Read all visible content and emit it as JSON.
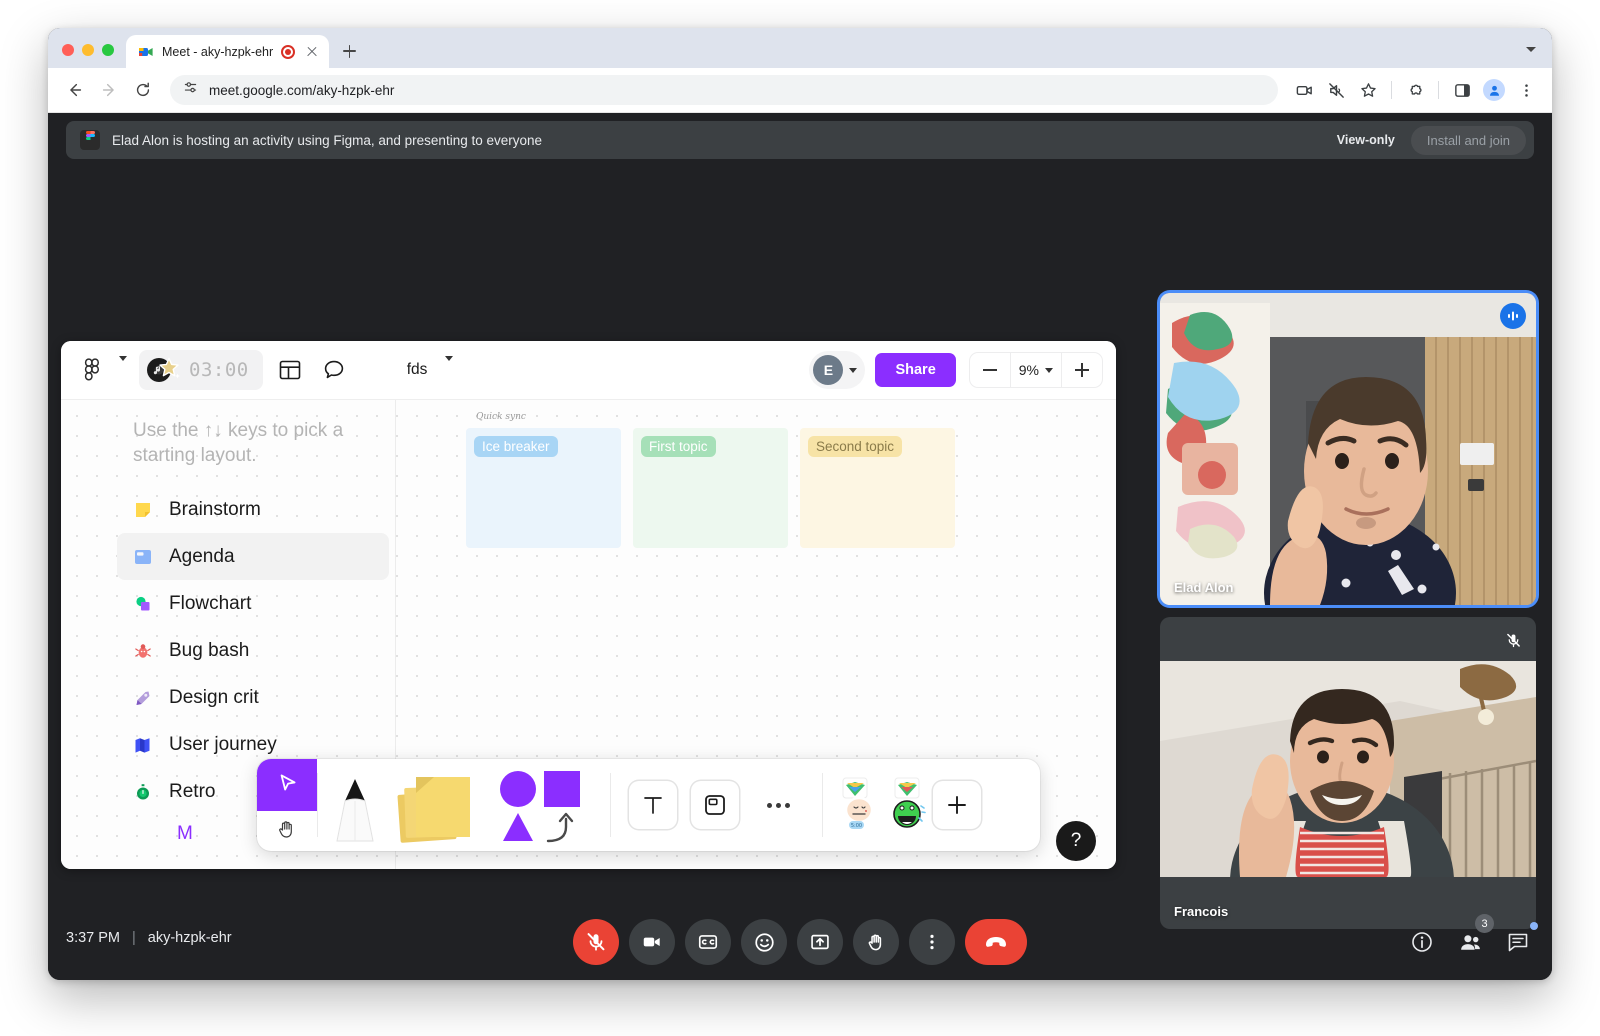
{
  "browser": {
    "tab": {
      "title": "Meet - aky-hzpk-ehr",
      "favicon_name": "google-meet-favicon",
      "recording_indicator": "recording-dot"
    },
    "omnibox": {
      "url": "meet.google.com/aky-hzpk-ehr",
      "site_info_icon": "tune-icon"
    },
    "toolbar_icons": [
      "back-arrow-icon",
      "forward-arrow-icon",
      "reload-icon",
      "screen-share-icon",
      "mute-site-icon",
      "bookmark-star-icon",
      "extensions-puzzle-icon",
      "side-panel-icon",
      "profile-avatar-icon",
      "chrome-menu-icon"
    ]
  },
  "banner": {
    "app_icon": "figma-icon",
    "message": "Elad Alon is hosting an activity using Figma, and presenting to everyone",
    "view_only_label": "View-only",
    "install_button_label": "Install and join"
  },
  "figma": {
    "logo_icon": "figma-logo-icon",
    "timer": {
      "value": "03:00",
      "icon": "music-timer-icon"
    },
    "layout_icon": "layout-panel-icon",
    "comment_icon": "comment-bubble-icon",
    "file_name": "fds",
    "avatar_initial": "E",
    "share_label": "Share",
    "zoom": {
      "value": "9%",
      "minus": "−",
      "plus": "+"
    },
    "hint_text": "Use the ↑↓ keys to pick a starting layout.",
    "layouts": [
      {
        "label": "Brainstorm",
        "icon": "sticky-note-icon",
        "selected": false
      },
      {
        "label": "Agenda",
        "icon": "agenda-board-icon",
        "selected": true
      },
      {
        "label": "Flowchart",
        "icon": "flowchart-icon",
        "selected": false
      },
      {
        "label": "Bug bash",
        "icon": "bug-icon",
        "selected": false
      },
      {
        "label": "Design crit",
        "icon": "pen-nib-icon",
        "selected": false
      },
      {
        "label": "User journey",
        "icon": "map-icon",
        "selected": false
      },
      {
        "label": "Retro",
        "icon": "stopwatch-icon",
        "selected": false
      }
    ],
    "more_label": "M",
    "board": {
      "title": "Quick sync",
      "columns": [
        {
          "label": "Ice breaker"
        },
        {
          "label": "First topic"
        },
        {
          "label": "Second topic"
        }
      ]
    },
    "tools": [
      {
        "name": "select-tool",
        "icon": "cursor-arrow-icon"
      },
      {
        "name": "hand-tool",
        "icon": "hand-icon"
      },
      {
        "name": "pen-tool",
        "icon": "marker-pen-icon"
      },
      {
        "name": "sticky-note-tool",
        "icon": "sticky-notes-icon"
      },
      {
        "name": "shapes-tool",
        "icon": "shapes-icon"
      },
      {
        "name": "text-tool",
        "icon": "text-t-icon"
      },
      {
        "name": "frame-tool",
        "icon": "frame-icon"
      },
      {
        "name": "more-tools",
        "icon": "ellipsis-icon"
      },
      {
        "name": "sticker-face",
        "icon": "party-face-sticker-icon"
      },
      {
        "name": "sticker-monster",
        "icon": "party-monster-sticker-icon"
      },
      {
        "name": "add-sticker",
        "icon": "plus-icon"
      }
    ],
    "help_label": "?"
  },
  "meet": {
    "tiles": [
      {
        "name": "Elad Alon",
        "badge": "speaking-indicator-icon",
        "speaking": true
      },
      {
        "name": "Francois",
        "badge": "mic-off-icon",
        "speaking": false
      }
    ],
    "time": "3:37 PM",
    "meeting_code": "aky-hzpk-ehr",
    "controls": [
      {
        "name": "microphone-toggle",
        "icon": "mic-off-icon",
        "state": "muted"
      },
      {
        "name": "camera-toggle",
        "icon": "camera-icon",
        "state": "on"
      },
      {
        "name": "captions-toggle",
        "icon": "closed-captions-icon",
        "state": "off"
      },
      {
        "name": "reactions-button",
        "icon": "emoji-smile-icon",
        "state": "off"
      },
      {
        "name": "present-button",
        "icon": "present-screen-icon",
        "state": "off"
      },
      {
        "name": "raise-hand-button",
        "icon": "raise-hand-icon",
        "state": "off"
      },
      {
        "name": "more-options-button",
        "icon": "vertical-ellipsis-icon",
        "state": "off"
      },
      {
        "name": "leave-call-button",
        "icon": "end-call-icon",
        "state": "danger"
      }
    ],
    "right_controls": [
      {
        "name": "meeting-details-button",
        "icon": "info-circle-icon",
        "badge": ""
      },
      {
        "name": "participants-button",
        "icon": "people-icon",
        "badge": "3"
      },
      {
        "name": "chat-button",
        "icon": "chat-icon",
        "badge": ""
      }
    ]
  },
  "colors": {
    "accent_purple": "#8b2eff",
    "meet_red": "#ea4335",
    "speaking_blue": "#1a73e8",
    "tile_border": "#4b8df8",
    "meet_bg": "#202124",
    "banner_bg": "#3c4043"
  }
}
